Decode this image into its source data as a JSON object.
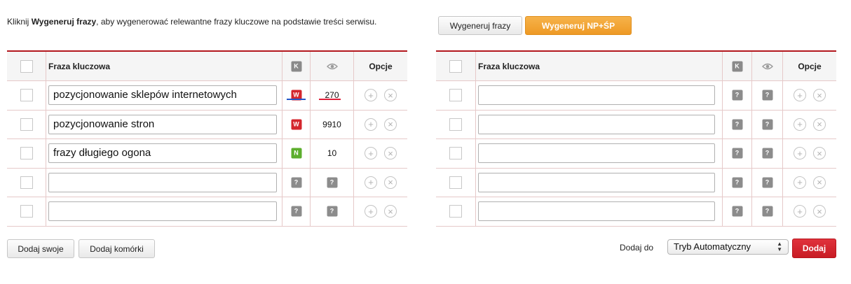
{
  "intro": {
    "prefix": "Kliknij ",
    "bold": "Wygeneruj frazy",
    "suffix": ", aby wygenerować relewantne frazy kluczowe na podstawie treści serwisu."
  },
  "buttons": {
    "generate": "Wygeneruj frazy",
    "generate_np": "Wygeneruj NP+ŚP",
    "add_own": "Dodaj swoje",
    "add_cells": "Dodaj komórki",
    "add": "Dodaj"
  },
  "table_headers": {
    "phrase": "Fraza kluczowa",
    "k_badge": "K",
    "options": "Opcje"
  },
  "left_rows": [
    {
      "phrase": "pozycjonowanie sklepów internetowych",
      "badge": "W",
      "badge_color": "#d4262d",
      "views": "270"
    },
    {
      "phrase": "pozycjonowanie stron",
      "badge": "W",
      "badge_color": "#d4262d",
      "views": "9910"
    },
    {
      "phrase": "frazy długiego ogona",
      "badge": "N",
      "badge_color": "#5cae2d",
      "views": "10"
    },
    {
      "phrase": "",
      "badge": "?",
      "badge_color": "#8c8c8c",
      "views": "?"
    },
    {
      "phrase": "",
      "badge": "?",
      "badge_color": "#8c8c8c",
      "views": "?"
    }
  ],
  "right_rows": [
    {
      "phrase": "",
      "badge": "?",
      "views": "?"
    },
    {
      "phrase": "",
      "badge": "?",
      "views": "?"
    },
    {
      "phrase": "",
      "badge": "?",
      "views": "?"
    },
    {
      "phrase": "",
      "badge": "?",
      "views": "?"
    },
    {
      "phrase": "",
      "badge": "?",
      "views": "?"
    }
  ],
  "icons": {
    "plus": "+",
    "close": "×",
    "add_icon": "plus-circle-icon",
    "remove_icon": "close-circle-icon",
    "eye_icon": "eye-icon"
  },
  "add_to": {
    "label": "Dodaj do",
    "selected": "Tryb Automatyczny"
  },
  "colors": {
    "accent_red": "#b3171d",
    "orange": "#ee9a25",
    "underline_blue": "#2456c8",
    "underline_red": "#e0203a"
  }
}
